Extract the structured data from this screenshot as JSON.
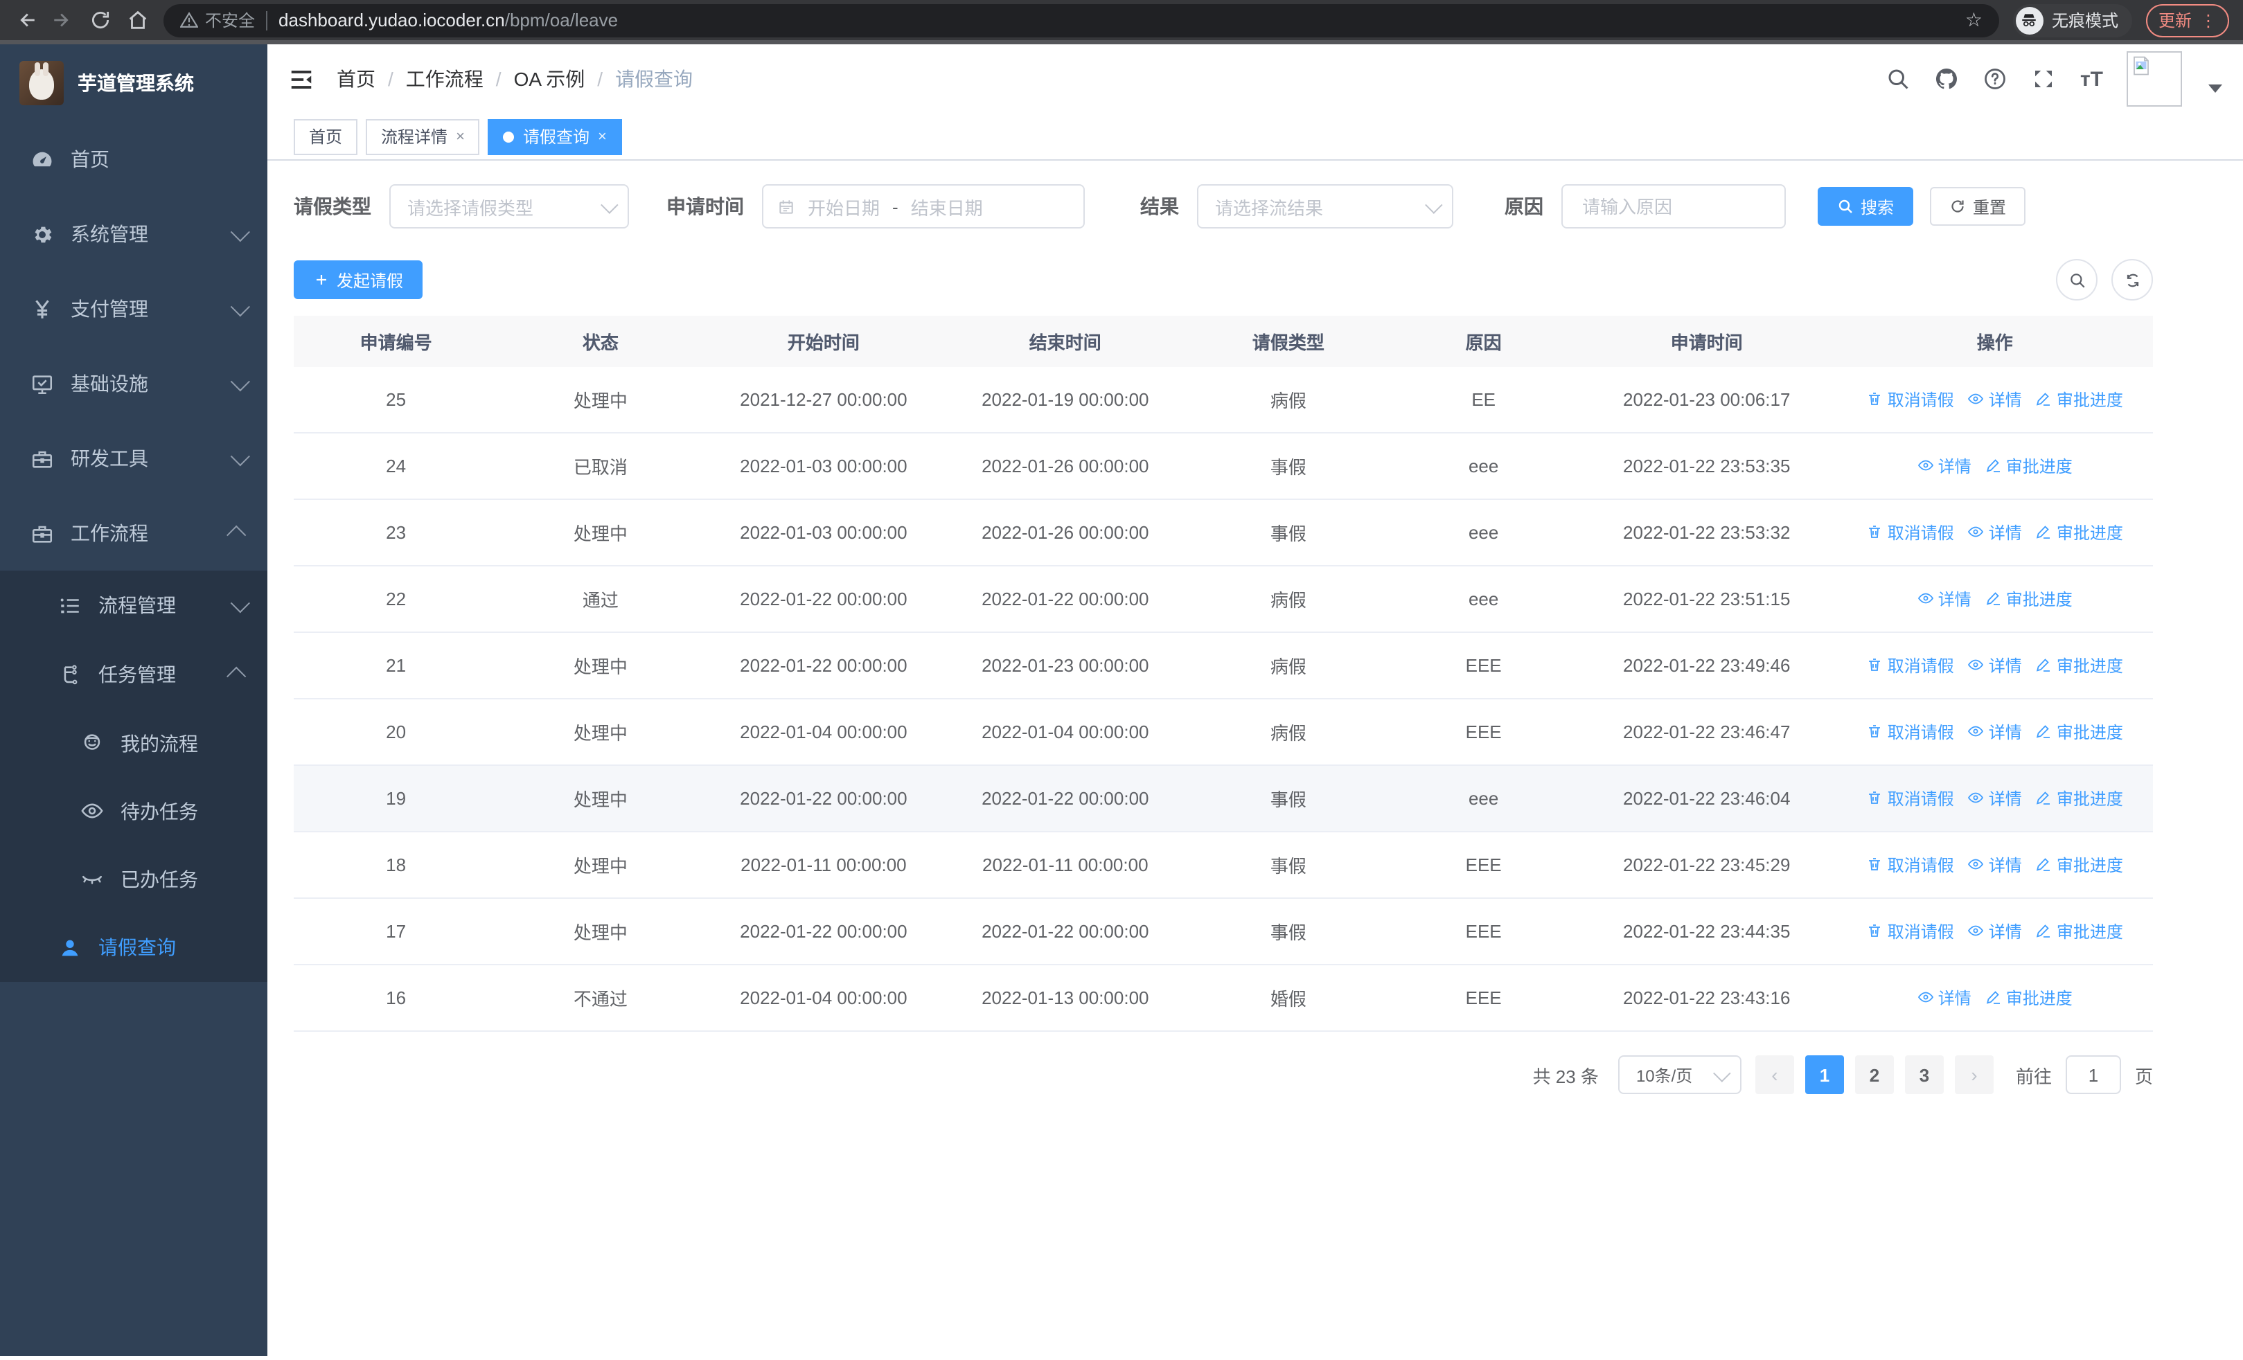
{
  "browser": {
    "security_label": "不安全",
    "url_host": "dashboard.yudao.iocoder.cn",
    "url_path": "/bpm/oa/leave",
    "star_icon": "☆",
    "incognito_label": "无痕模式",
    "update_label": "更新",
    "menu_dots": "⋮"
  },
  "sidebar": {
    "title": "芋道管理系统",
    "home": "首页",
    "system": "系统管理",
    "payment": "支付管理",
    "infra": "基础设施",
    "devtools": "研发工具",
    "workflow": "工作流程",
    "process_mgmt": "流程管理",
    "task_mgmt": "任务管理",
    "my_process": "我的流程",
    "todo_tasks": "待办任务",
    "done_tasks": "已办任务",
    "leave_query": "请假查询"
  },
  "header": {
    "breadcrumb": [
      "首页",
      "工作流程",
      "OA 示例",
      "请假查询"
    ]
  },
  "tabs": [
    {
      "label": "首页"
    },
    {
      "label": "流程详情"
    },
    {
      "label": "请假查询"
    }
  ],
  "filters": {
    "type_label": "请假类型",
    "type_placeholder": "请选择请假类型",
    "time_label": "申请时间",
    "start_placeholder": "开始日期",
    "range_separator": "-",
    "end_placeholder": "结束日期",
    "result_label": "结果",
    "result_placeholder": "请选择流结果",
    "reason_label": "原因",
    "reason_placeholder": "请输入原因",
    "search_button": "搜索",
    "reset_button": "重置"
  },
  "toolbar": {
    "create_button": "发起请假"
  },
  "table": {
    "columns": [
      "申请编号",
      "状态",
      "开始时间",
      "结束时间",
      "请假类型",
      "原因",
      "申请时间",
      "操作"
    ],
    "action_labels": {
      "cancel": "取消请假",
      "detail": "详情",
      "progress": "审批进度"
    },
    "rows": [
      {
        "id": "25",
        "status": "处理中",
        "start": "2021-12-27 00:00:00",
        "end": "2022-01-19 00:00:00",
        "type": "病假",
        "reason": "EE",
        "apply_time": "2022-01-23 00:06:17",
        "actions": [
          "cancel",
          "detail",
          "progress"
        ],
        "highlight": false
      },
      {
        "id": "24",
        "status": "已取消",
        "start": "2022-01-03 00:00:00",
        "end": "2022-01-26 00:00:00",
        "type": "事假",
        "reason": "eee",
        "apply_time": "2022-01-22 23:53:35",
        "actions": [
          "detail",
          "progress"
        ],
        "highlight": false
      },
      {
        "id": "23",
        "status": "处理中",
        "start": "2022-01-03 00:00:00",
        "end": "2022-01-26 00:00:00",
        "type": "事假",
        "reason": "eee",
        "apply_time": "2022-01-22 23:53:32",
        "actions": [
          "cancel",
          "detail",
          "progress"
        ],
        "highlight": false
      },
      {
        "id": "22",
        "status": "通过",
        "start": "2022-01-22 00:00:00",
        "end": "2022-01-22 00:00:00",
        "type": "病假",
        "reason": "eee",
        "apply_time": "2022-01-22 23:51:15",
        "actions": [
          "detail",
          "progress"
        ],
        "highlight": false
      },
      {
        "id": "21",
        "status": "处理中",
        "start": "2022-01-22 00:00:00",
        "end": "2022-01-23 00:00:00",
        "type": "病假",
        "reason": "EEE",
        "apply_time": "2022-01-22 23:49:46",
        "actions": [
          "cancel",
          "detail",
          "progress"
        ],
        "highlight": false
      },
      {
        "id": "20",
        "status": "处理中",
        "start": "2022-01-04 00:00:00",
        "end": "2022-01-04 00:00:00",
        "type": "病假",
        "reason": "EEE",
        "apply_time": "2022-01-22 23:46:47",
        "actions": [
          "cancel",
          "detail",
          "progress"
        ],
        "highlight": false
      },
      {
        "id": "19",
        "status": "处理中",
        "start": "2022-01-22 00:00:00",
        "end": "2022-01-22 00:00:00",
        "type": "事假",
        "reason": "eee",
        "apply_time": "2022-01-22 23:46:04",
        "actions": [
          "cancel",
          "detail",
          "progress"
        ],
        "highlight": true
      },
      {
        "id": "18",
        "status": "处理中",
        "start": "2022-01-11 00:00:00",
        "end": "2022-01-11 00:00:00",
        "type": "事假",
        "reason": "EEE",
        "apply_time": "2022-01-22 23:45:29",
        "actions": [
          "cancel",
          "detail",
          "progress"
        ],
        "highlight": false
      },
      {
        "id": "17",
        "status": "处理中",
        "start": "2022-01-22 00:00:00",
        "end": "2022-01-22 00:00:00",
        "type": "事假",
        "reason": "EEE",
        "apply_time": "2022-01-22 23:44:35",
        "actions": [
          "cancel",
          "detail",
          "progress"
        ],
        "highlight": false
      },
      {
        "id": "16",
        "status": "不通过",
        "start": "2022-01-04 00:00:00",
        "end": "2022-01-13 00:00:00",
        "type": "婚假",
        "reason": "EEE",
        "apply_time": "2022-01-22 23:43:16",
        "actions": [
          "detail",
          "progress"
        ],
        "highlight": false
      }
    ]
  },
  "pagination": {
    "total": "共 23 条",
    "page_size": "10条/页",
    "pages": [
      "1",
      "2",
      "3"
    ],
    "goto_label": "前往",
    "goto_value": "1",
    "goto_suffix": "页"
  },
  "colors": {
    "accent": "#409eff",
    "sidebar_bg": "#304156",
    "sidebar_sub_bg": "#273445"
  }
}
